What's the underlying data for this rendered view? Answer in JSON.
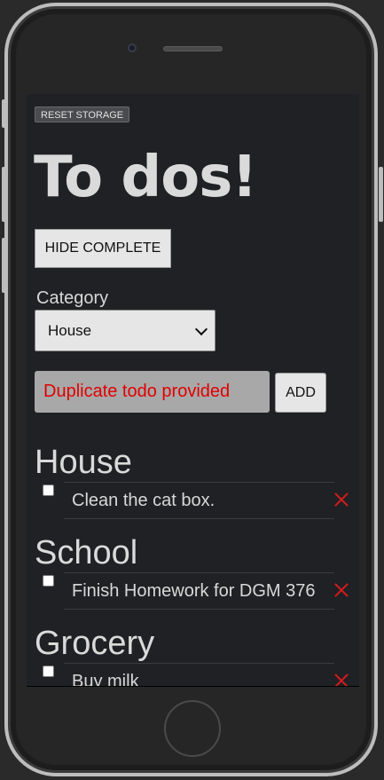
{
  "app": {
    "reset_label": "RESET STORAGE",
    "title": "To dos!",
    "hide_label": "HIDE COMPLETE",
    "category_label": "Category",
    "category_selected": "House",
    "input_value": "Duplicate todo provided",
    "add_label": "ADD"
  },
  "groups": [
    {
      "name": "House",
      "todos": [
        {
          "text": "Clean the cat box.",
          "checked": false
        }
      ]
    },
    {
      "name": "School",
      "todos": [
        {
          "text": "Finish Homework for DGM 376",
          "checked": false
        }
      ]
    },
    {
      "name": "Grocery",
      "todos": [
        {
          "text": "Buy milk",
          "checked": false
        }
      ]
    }
  ],
  "colors": {
    "screen_bg": "#202124",
    "error_text": "#e00000",
    "delete_icon": "#d81b1b"
  },
  "icons": {
    "delete": "close-icon",
    "select": "chevron-down-icon"
  }
}
